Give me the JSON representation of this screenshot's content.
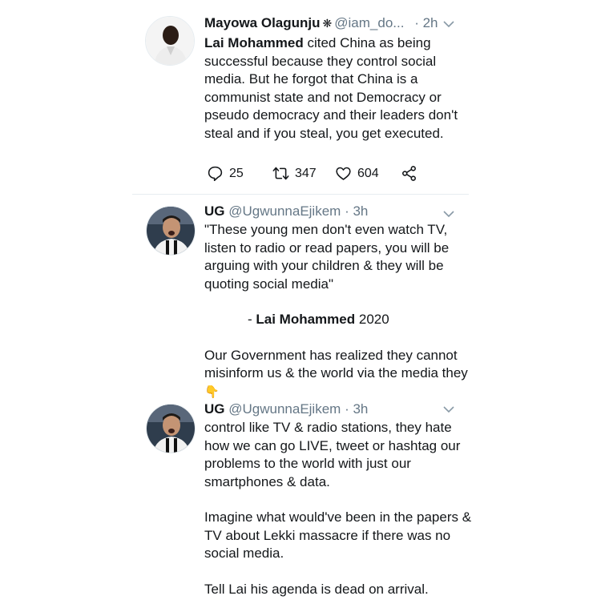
{
  "tweet1": {
    "name": "Mayowa Olagunju",
    "handle": "@iam_do...",
    "time": "· 2h",
    "mention": "Lai Mohammed",
    "text_after_mention": " cited China as being successful because they control social media. But he forgot that China is a communist state and not Democracy or pseudo democracy and their leaders don't steal and if you steal, you get executed.",
    "replies": "25",
    "retweets": "347",
    "likes": "604"
  },
  "tweet2": {
    "name": "UG",
    "handle": "@UgwunnaEjikem",
    "time": "· 3h",
    "quote": "\"These young men don't even watch TV, listen to radio or read papers, you will be arguing with your children & they will be quoting social media\"",
    "attribution_prefix": "- ",
    "attribution_name": "Lai Mohammed",
    "attribution_year": " 2020",
    "text2": "Our Government has realized they cannot misinform us & the world via the media they",
    "emoji": "👇"
  },
  "tweet3": {
    "name": "UG",
    "handle": "@UgwunnaEjikem",
    "time": "· 3h",
    "para1": "control like TV & radio stations, they hate how we can go LIVE, tweet or hashtag our problems to the world with just our smartphones & data.",
    "para2": "Imagine what would've been in the papers & TV about Lekki massacre if there was no social media.",
    "para3": "Tell Lai his agenda is dead on arrival."
  },
  "icons": {
    "verified": "verified-badge-icon",
    "chevron": "chevron-down-icon",
    "reply": "reply-icon",
    "retweet": "retweet-icon",
    "like": "heart-icon",
    "share": "share-icon"
  }
}
